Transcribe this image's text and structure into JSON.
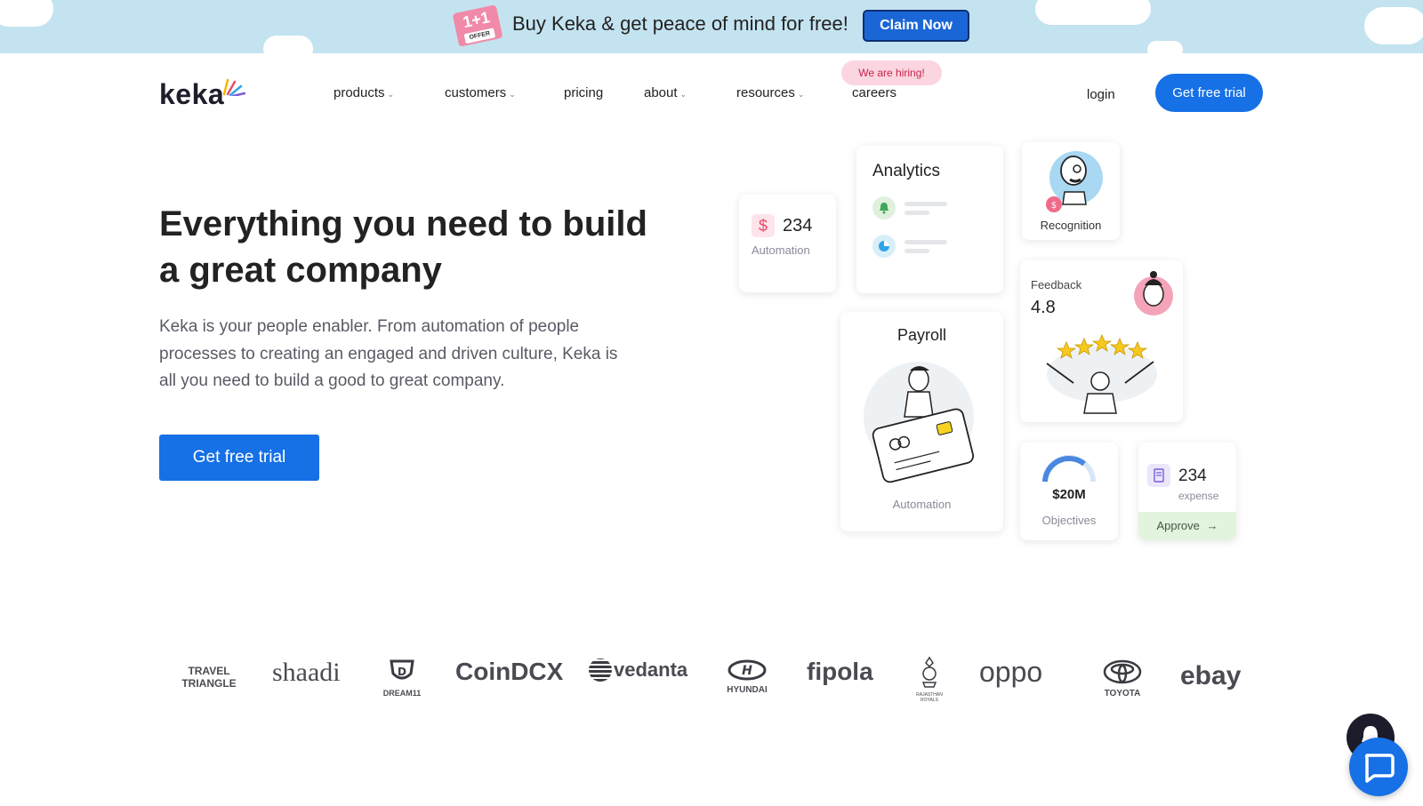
{
  "promo": {
    "badge_main": "1+1",
    "badge_tag": "OFFER",
    "text": "Buy Keka & get peace of mind for free!",
    "cta": "Claim Now"
  },
  "nav": {
    "logo": "keka",
    "items": [
      {
        "label": "products",
        "dropdown": true
      },
      {
        "label": "customers",
        "dropdown": true
      },
      {
        "label": "pricing",
        "dropdown": false
      },
      {
        "label": "about",
        "dropdown": true
      },
      {
        "label": "resources",
        "dropdown": true
      },
      {
        "label": "careers",
        "dropdown": false
      }
    ],
    "hiring_badge": "We are hiring!",
    "login": "login",
    "cta": "Get free trial"
  },
  "hero": {
    "title": "Everything you need to build a great company",
    "description": "Keka is your people enabler. From automation of people processes to creating an engaged and driven culture, Keka is all you need to build a good to great company.",
    "cta": "Get free trial"
  },
  "cards": {
    "automation_small": {
      "value": "234",
      "label": "Automation"
    },
    "analytics": {
      "title": "Analytics"
    },
    "recognition": {
      "label": "Recognition"
    },
    "feedback": {
      "title": "Feedback",
      "rating": "4.8"
    },
    "payroll": {
      "title": "Payroll",
      "label": "Automation"
    },
    "objectives": {
      "value": "$20M",
      "label": "Objectives"
    },
    "expense": {
      "value": "234",
      "label": "expense",
      "action": "Approve"
    }
  },
  "customers": [
    "TRAVEL TRIANGLE",
    "shaadi",
    "DREAM11",
    "CoinDCX",
    "vedanta",
    "HYUNDAI",
    "fipola",
    "RAJASTHAN ROYALS",
    "oppo",
    "TOYOTA",
    "ebay"
  ],
  "colors": {
    "primary": "#1670e6",
    "banner_bg": "#c4e3f0",
    "hiring_bg": "#fbd5df",
    "hiring_text": "#c4244e",
    "approve_bg": "#e3f4de"
  }
}
